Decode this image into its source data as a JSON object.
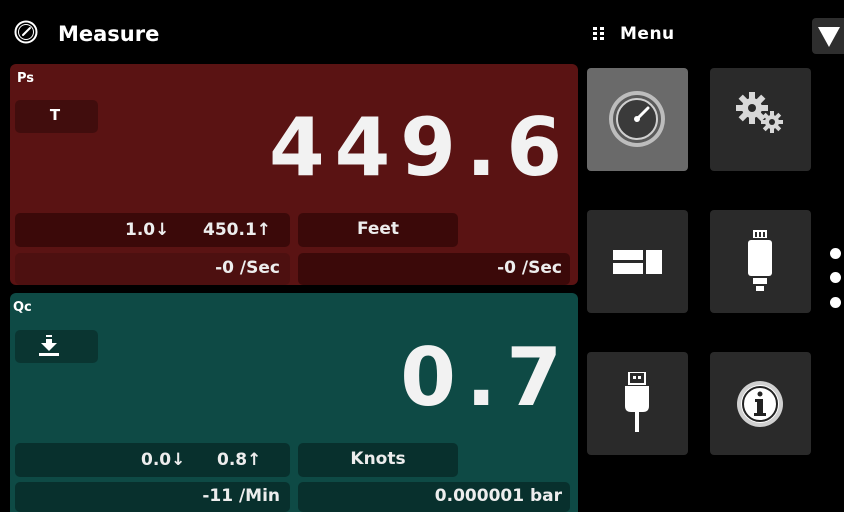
{
  "header": {
    "title": "Measure",
    "menu_label": "Menu"
  },
  "channels": [
    {
      "name": "Ps",
      "mode": "T",
      "reading": "449.6",
      "min": "1.0↓",
      "max": "450.1↑",
      "unit": "Feet",
      "rate": "-0 /Sec",
      "rate2": "-0 /Sec",
      "color": "#5a1313"
    },
    {
      "name": "Qc",
      "mode_icon": "tare-icon",
      "reading": "0.7",
      "min": "0.0↓",
      "max": "0.8↑",
      "unit": "Knots",
      "rate": "-11 /Min",
      "rate2": "0.000001 bar",
      "color": "#0e4a45"
    }
  ],
  "menu_tiles": [
    {
      "icon": "gauge-icon",
      "active": true
    },
    {
      "icon": "settings-gears-icon",
      "active": false
    },
    {
      "icon": "display-layout-icon",
      "active": false
    },
    {
      "icon": "sensor-module-icon",
      "active": false
    },
    {
      "icon": "usb-icon",
      "active": false
    },
    {
      "icon": "info-icon",
      "active": false
    }
  ],
  "pager": {
    "pages": 3,
    "current": 1
  }
}
